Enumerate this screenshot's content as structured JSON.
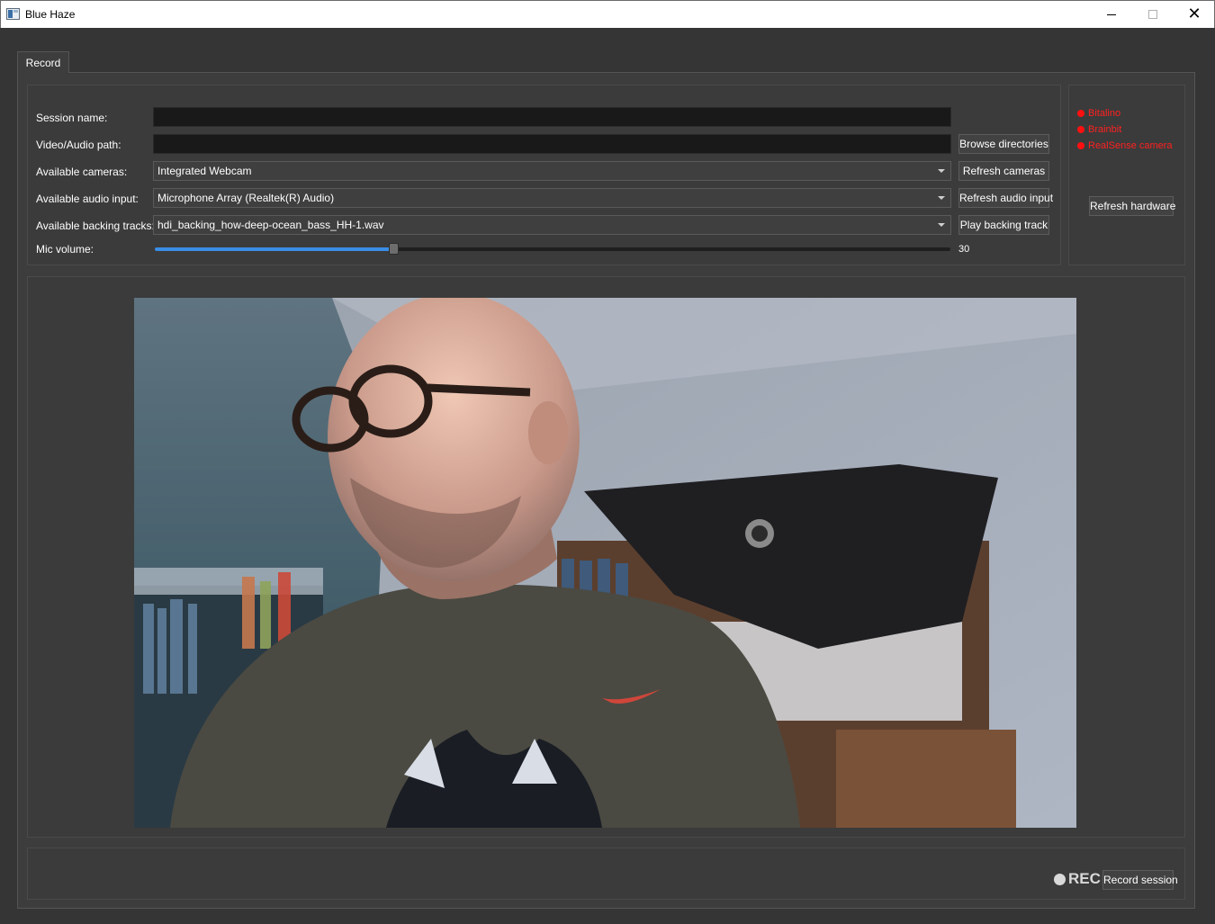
{
  "window": {
    "title": "Blue Haze",
    "controls": [
      "minimize",
      "maximize",
      "close"
    ]
  },
  "tabs": [
    {
      "label": "Record",
      "active": true
    }
  ],
  "form": {
    "session_name_label": "Session name:",
    "session_name_value": "",
    "video_path_label": "Video/Audio path:",
    "video_path_value": "",
    "cameras_label": "Available cameras:",
    "cameras_selected": "Integrated Webcam",
    "audio_label": "Available audio input:",
    "audio_selected": "Microphone Array (Realtek(R) Audio)",
    "backing_label": "Available backing tracks:",
    "backing_selected": "hdi_backing_how-deep-ocean_bass_HH-1.wav",
    "mic_label": "Mic volume:",
    "mic_value": "30",
    "mic_fraction": 0.3
  },
  "buttons": {
    "browse": "Browse directories",
    "refresh_cameras": "Refresh cameras",
    "refresh_audio": "Refresh audio input",
    "play_backing": "Play backing track",
    "refresh_hardware": "Refresh hardware",
    "record_session": "Record session"
  },
  "hardware": [
    {
      "label": "Bitalino",
      "status_color": "#ff1010"
    },
    {
      "label": "Brainbit",
      "status_color": "#ff1010"
    },
    {
      "label": "RealSense camera",
      "status_color": "#ff1010"
    }
  ],
  "recording": {
    "indicator": "REC",
    "indicator_color": "#d9d9d9"
  },
  "accent_color": "#3a8ee6"
}
